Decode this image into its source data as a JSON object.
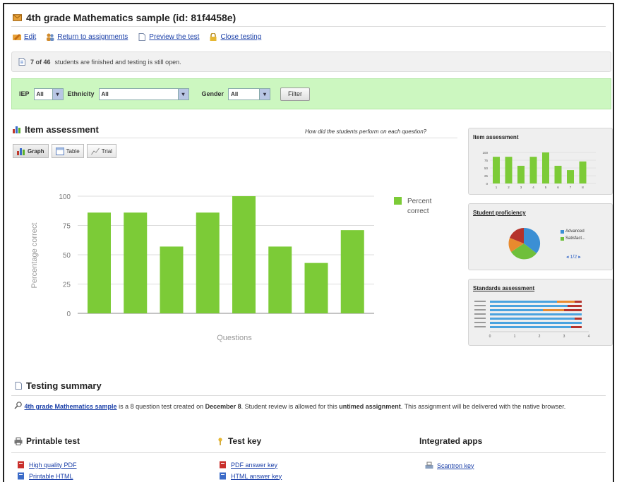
{
  "header": {
    "title": "4th grade Mathematics sample (id: 81f4458e)"
  },
  "actions": [
    {
      "label": "Edit",
      "icon": "pencil-icon"
    },
    {
      "label": "Return to assignments",
      "icon": "people-icon"
    },
    {
      "label": "Preview the test",
      "icon": "document-icon"
    },
    {
      "label": "Close testing",
      "icon": "lock-icon"
    }
  ],
  "notice": {
    "count": "7 of 46",
    "text": "students are finished and testing is still open."
  },
  "filters": {
    "iep_label": "IEP",
    "iep_value": "All",
    "ethnicity_label": "Ethnicity",
    "ethnicity_value": "All",
    "gender_label": "Gender",
    "gender_value": "All",
    "button_label": "Filter"
  },
  "item_assessment": {
    "title": "Item assessment",
    "hint": "How did the students perform on each question?",
    "tabs": [
      "Graph",
      "Table",
      "Trial"
    ]
  },
  "chart_data": {
    "type": "bar",
    "categories": [
      "1",
      "2",
      "3",
      "4",
      "5",
      "6",
      "7",
      "8"
    ],
    "values": [
      86,
      86,
      57,
      86,
      100,
      57,
      43,
      71
    ],
    "xlabel": "Questions",
    "ylabel": "Percentage correct",
    "ylim": [
      0,
      100
    ],
    "yticks": [
      "0",
      "25",
      "50",
      "75",
      "100"
    ],
    "legend": [
      "Percent",
      "correct"
    ],
    "legend_placement": "right",
    "bar_color": "#7ccb37",
    "grid": true
  },
  "sidebar": {
    "mini_item_title": "Item assessment",
    "mini_item_ticks": [
      "100",
      "75",
      "50",
      "25",
      "0"
    ],
    "proficiency_title": "Student proficiency",
    "proficiency_legend": [
      "Advanced",
      "Satisfact..."
    ],
    "proficiency_pager": "1/2",
    "standards_title": "Standards assessment",
    "standards_axis": [
      "0",
      "1",
      "2",
      "3",
      "4"
    ]
  },
  "summary": {
    "title": "Testing summary",
    "test_link": "4th grade Mathematics sample",
    "text_1": " is a 8 question test created on ",
    "date": "December 8",
    "text_2": ". Student review is allowed for this ",
    "untimed": "untimed assignment",
    "text_3": ". This assignment will be delivered with the native browser."
  },
  "printable": {
    "title": "Printable test",
    "links": [
      "High quality PDF",
      "Printable HTML"
    ]
  },
  "testkey": {
    "title": "Test key",
    "links": [
      "PDF answer key",
      "HTML answer key"
    ]
  },
  "apps": {
    "title": "Integrated apps",
    "links": [
      "Scantron key"
    ]
  }
}
